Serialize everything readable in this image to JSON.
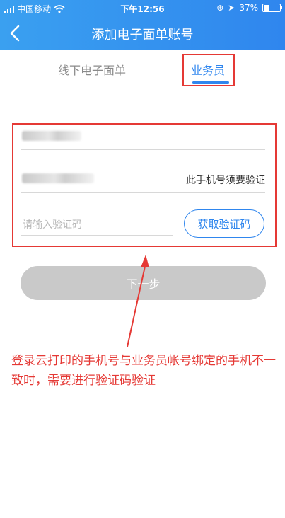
{
  "status_bar": {
    "carrier": "中国移动",
    "time": "下午12:56",
    "battery": "37%"
  },
  "nav": {
    "title": "添加电子面单账号"
  },
  "tabs": [
    {
      "label": "线下电子面单"
    },
    {
      "label": "业务员"
    }
  ],
  "form": {
    "account_value": "02100.2",
    "phone_value": "1**********97",
    "phone_hint": "此手机号须要验证",
    "code_placeholder": "请输入验证码",
    "get_code_label": "获取验证码"
  },
  "next_button": {
    "label": "下一步"
  },
  "annotation": {
    "text": "登录云打印的手机号与业务员帐号绑定的手机不一致时，需要进行验证码验证"
  },
  "colors": {
    "primary": "#2f86ee",
    "highlight": "#e53935",
    "disabled": "#c9c9c9"
  }
}
